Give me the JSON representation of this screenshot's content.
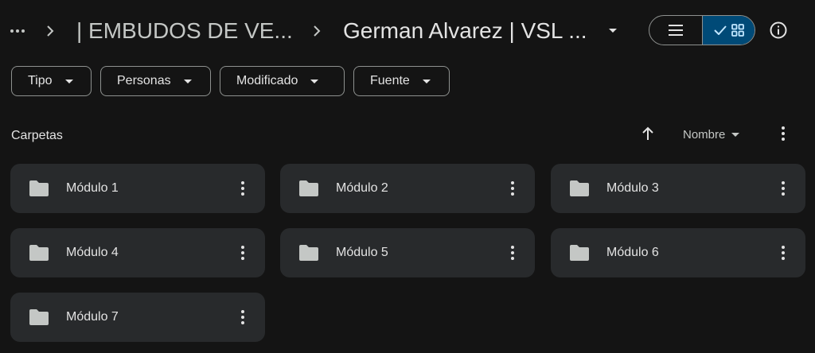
{
  "breadcrumb": {
    "more_icon": "more-horizontal-icon",
    "separator_icon": "chevron-right-icon",
    "parent": "| EMBUDOS DE VE...",
    "current": "German Alvarez | VSL ...",
    "current_menu_icon": "caret-down-icon"
  },
  "view_toggle": {
    "list_icon": "list-view-icon",
    "grid_icon": "grid-view-icon",
    "grid_check_icon": "check-icon",
    "selected": "grid"
  },
  "info_icon": "info-icon",
  "filters": [
    {
      "label": "Tipo"
    },
    {
      "label": "Personas"
    },
    {
      "label": "Modificado"
    },
    {
      "label": "Fuente"
    }
  ],
  "section": {
    "title": "Carpetas",
    "sort_direction_icon": "arrow-up-icon",
    "sort_label": "Nombre",
    "more_icon": "more-vertical-icon"
  },
  "folders": [
    {
      "name": "Módulo 1"
    },
    {
      "name": "Módulo 2"
    },
    {
      "name": "Módulo 3"
    },
    {
      "name": "Módulo 4"
    },
    {
      "name": "Módulo 5"
    },
    {
      "name": "Módulo 6"
    },
    {
      "name": "Módulo 7"
    }
  ],
  "colors": {
    "background": "#141414",
    "card": "#282a2c",
    "selected_toggle": "#004a77",
    "text": "#e3e3e3",
    "icon": "#c4c7c5"
  }
}
